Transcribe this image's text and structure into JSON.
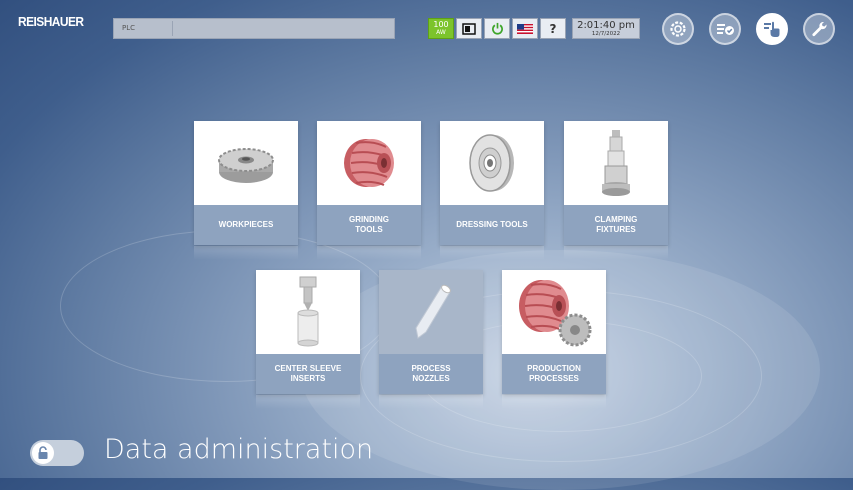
{
  "header": {
    "logo": "REISHAUER",
    "plc_label": "PLC",
    "status": {
      "power_value": "100",
      "power_unit": "AW",
      "help": "?"
    },
    "clock": {
      "time": "2:01:40 pm",
      "date": "12/7/2022"
    },
    "icons": [
      "gear-check-icon",
      "list-check-icon",
      "hand-pointer-icon",
      "wrench-person-icon"
    ]
  },
  "tiles": [
    {
      "label": "WORKPIECES",
      "icon": "gear-icon"
    },
    {
      "label": "GRINDING\nTOOLS",
      "icon": "grinding-worm-icon"
    },
    {
      "label": "DRESSING TOOLS",
      "icon": "dressing-disc-icon"
    },
    {
      "label": "CLAMPING\nFIXTURES",
      "icon": "clamping-fixture-icon"
    },
    {
      "label": "CENTER SLEEVE\nINSERTS",
      "icon": "center-sleeve-icon"
    },
    {
      "label": "PROCESS\nNOZZLES",
      "icon": "nozzle-icon"
    },
    {
      "label": "PRODUCTION\nPROCESSES",
      "icon": "production-process-icon"
    }
  ],
  "footer": {
    "title": "Data administration"
  },
  "colors": {
    "accent_green": "#7cc42b",
    "tile_label_bg": "#8ea3bf",
    "grinding_red": "#d9777b"
  }
}
